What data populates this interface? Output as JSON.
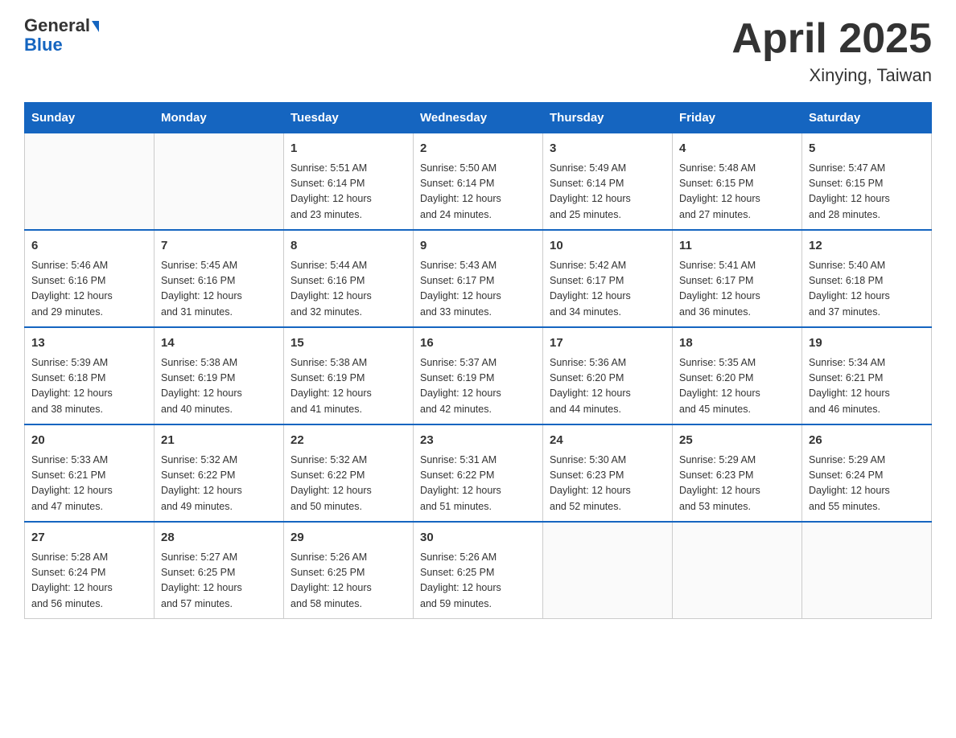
{
  "header": {
    "logo_general": "General",
    "logo_blue": "Blue",
    "month_year": "April 2025",
    "location": "Xinying, Taiwan"
  },
  "weekdays": [
    "Sunday",
    "Monday",
    "Tuesday",
    "Wednesday",
    "Thursday",
    "Friday",
    "Saturday"
  ],
  "weeks": [
    [
      {
        "day": "",
        "info": ""
      },
      {
        "day": "",
        "info": ""
      },
      {
        "day": "1",
        "info": "Sunrise: 5:51 AM\nSunset: 6:14 PM\nDaylight: 12 hours\nand 23 minutes."
      },
      {
        "day": "2",
        "info": "Sunrise: 5:50 AM\nSunset: 6:14 PM\nDaylight: 12 hours\nand 24 minutes."
      },
      {
        "day": "3",
        "info": "Sunrise: 5:49 AM\nSunset: 6:14 PM\nDaylight: 12 hours\nand 25 minutes."
      },
      {
        "day": "4",
        "info": "Sunrise: 5:48 AM\nSunset: 6:15 PM\nDaylight: 12 hours\nand 27 minutes."
      },
      {
        "day": "5",
        "info": "Sunrise: 5:47 AM\nSunset: 6:15 PM\nDaylight: 12 hours\nand 28 minutes."
      }
    ],
    [
      {
        "day": "6",
        "info": "Sunrise: 5:46 AM\nSunset: 6:16 PM\nDaylight: 12 hours\nand 29 minutes."
      },
      {
        "day": "7",
        "info": "Sunrise: 5:45 AM\nSunset: 6:16 PM\nDaylight: 12 hours\nand 31 minutes."
      },
      {
        "day": "8",
        "info": "Sunrise: 5:44 AM\nSunset: 6:16 PM\nDaylight: 12 hours\nand 32 minutes."
      },
      {
        "day": "9",
        "info": "Sunrise: 5:43 AM\nSunset: 6:17 PM\nDaylight: 12 hours\nand 33 minutes."
      },
      {
        "day": "10",
        "info": "Sunrise: 5:42 AM\nSunset: 6:17 PM\nDaylight: 12 hours\nand 34 minutes."
      },
      {
        "day": "11",
        "info": "Sunrise: 5:41 AM\nSunset: 6:17 PM\nDaylight: 12 hours\nand 36 minutes."
      },
      {
        "day": "12",
        "info": "Sunrise: 5:40 AM\nSunset: 6:18 PM\nDaylight: 12 hours\nand 37 minutes."
      }
    ],
    [
      {
        "day": "13",
        "info": "Sunrise: 5:39 AM\nSunset: 6:18 PM\nDaylight: 12 hours\nand 38 minutes."
      },
      {
        "day": "14",
        "info": "Sunrise: 5:38 AM\nSunset: 6:19 PM\nDaylight: 12 hours\nand 40 minutes."
      },
      {
        "day": "15",
        "info": "Sunrise: 5:38 AM\nSunset: 6:19 PM\nDaylight: 12 hours\nand 41 minutes."
      },
      {
        "day": "16",
        "info": "Sunrise: 5:37 AM\nSunset: 6:19 PM\nDaylight: 12 hours\nand 42 minutes."
      },
      {
        "day": "17",
        "info": "Sunrise: 5:36 AM\nSunset: 6:20 PM\nDaylight: 12 hours\nand 44 minutes."
      },
      {
        "day": "18",
        "info": "Sunrise: 5:35 AM\nSunset: 6:20 PM\nDaylight: 12 hours\nand 45 minutes."
      },
      {
        "day": "19",
        "info": "Sunrise: 5:34 AM\nSunset: 6:21 PM\nDaylight: 12 hours\nand 46 minutes."
      }
    ],
    [
      {
        "day": "20",
        "info": "Sunrise: 5:33 AM\nSunset: 6:21 PM\nDaylight: 12 hours\nand 47 minutes."
      },
      {
        "day": "21",
        "info": "Sunrise: 5:32 AM\nSunset: 6:22 PM\nDaylight: 12 hours\nand 49 minutes."
      },
      {
        "day": "22",
        "info": "Sunrise: 5:32 AM\nSunset: 6:22 PM\nDaylight: 12 hours\nand 50 minutes."
      },
      {
        "day": "23",
        "info": "Sunrise: 5:31 AM\nSunset: 6:22 PM\nDaylight: 12 hours\nand 51 minutes."
      },
      {
        "day": "24",
        "info": "Sunrise: 5:30 AM\nSunset: 6:23 PM\nDaylight: 12 hours\nand 52 minutes."
      },
      {
        "day": "25",
        "info": "Sunrise: 5:29 AM\nSunset: 6:23 PM\nDaylight: 12 hours\nand 53 minutes."
      },
      {
        "day": "26",
        "info": "Sunrise: 5:29 AM\nSunset: 6:24 PM\nDaylight: 12 hours\nand 55 minutes."
      }
    ],
    [
      {
        "day": "27",
        "info": "Sunrise: 5:28 AM\nSunset: 6:24 PM\nDaylight: 12 hours\nand 56 minutes."
      },
      {
        "day": "28",
        "info": "Sunrise: 5:27 AM\nSunset: 6:25 PM\nDaylight: 12 hours\nand 57 minutes."
      },
      {
        "day": "29",
        "info": "Sunrise: 5:26 AM\nSunset: 6:25 PM\nDaylight: 12 hours\nand 58 minutes."
      },
      {
        "day": "30",
        "info": "Sunrise: 5:26 AM\nSunset: 6:25 PM\nDaylight: 12 hours\nand 59 minutes."
      },
      {
        "day": "",
        "info": ""
      },
      {
        "day": "",
        "info": ""
      },
      {
        "day": "",
        "info": ""
      }
    ]
  ]
}
